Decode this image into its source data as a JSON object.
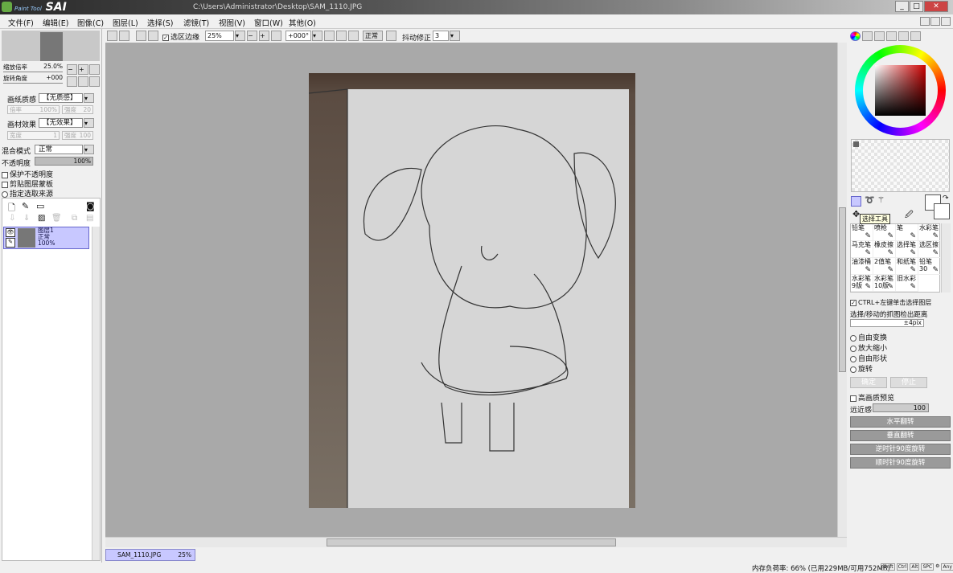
{
  "window": {
    "app_name": "SAI",
    "app_subtitle": "Paint Tool",
    "file_path": "C:\\Users\\Administrator\\Desktop\\SAM_1110.JPG"
  },
  "menu": [
    "文件(F)",
    "编辑(E)",
    "图像(C)",
    "图层(L)",
    "选择(S)",
    "滤镜(T)",
    "视图(V)",
    "窗口(W)",
    "其他(O)"
  ],
  "toolbar": {
    "selection_edge_label": "选区边缘",
    "zoom": "25%",
    "rotation": "+000°",
    "mode": "正常",
    "stabilizer_label": "抖动修正",
    "stabilizer_value": "3"
  },
  "navigator": {
    "zoom_label": "缩放倍率",
    "zoom_value": "25.0%",
    "angle_label": "旋转角度",
    "angle_value": "+000"
  },
  "texture": {
    "label": "画纸质感",
    "value": "【无质感】",
    "scale_label": "倍率",
    "scale_value": "100%",
    "strength_label": "强度",
    "strength_value": "20"
  },
  "effect": {
    "label": "画材效果",
    "value": "【无效果】",
    "width_label": "宽度",
    "width_value": "1",
    "strength_label": "强度",
    "strength_value": "100"
  },
  "blend": {
    "label": "混合模式",
    "value": "正常",
    "opacity_label": "不透明度",
    "opacity_value": "100%"
  },
  "options": [
    "保护不透明度",
    "剪贴图层蒙板",
    "指定选取来源"
  ],
  "layer": {
    "name": "图层1",
    "mode": "正常",
    "opacity": "100%"
  },
  "tools": {
    "tooltip": "选择工具",
    "brushes": [
      "铅笔",
      "喷枪",
      "笔",
      "水彩笔",
      "马克笔",
      "橡皮擦",
      "选择笔",
      "选区擦",
      "油漆桶",
      "2值笔",
      "和纸笔",
      "铅笔30",
      "水彩笔9版",
      "水彩笔10版",
      "旧水彩"
    ]
  },
  "transform": {
    "ctrl_label": "CTRL+左键单击选择图层",
    "distance_label": "选择/移动的抓图检出距离",
    "distance_value": "±4pix",
    "modes": [
      "自由变换",
      "放大缩小",
      "自由形状",
      "旋转"
    ],
    "ok": "确定",
    "cancel": "停止",
    "hq_preview": "高画质预览",
    "perspective_label": "远近感",
    "perspective_value": "100",
    "buttons": [
      "水平翻转",
      "垂直翻转",
      "逆时针90度旋转",
      "顺时针90度旋转"
    ]
  },
  "doc_tab": {
    "name": "SAM_1110.JPG",
    "zoom": "25%"
  },
  "status": {
    "memory": "内存负荷率: 66% (已用229MB/可用752MB)",
    "keys": [
      "Shift",
      "Ctrl",
      "Alt",
      "SPC",
      "Any"
    ]
  },
  "colors": {
    "accent": "#c8c8ff",
    "canvas_bg": "#a9a9a9"
  }
}
